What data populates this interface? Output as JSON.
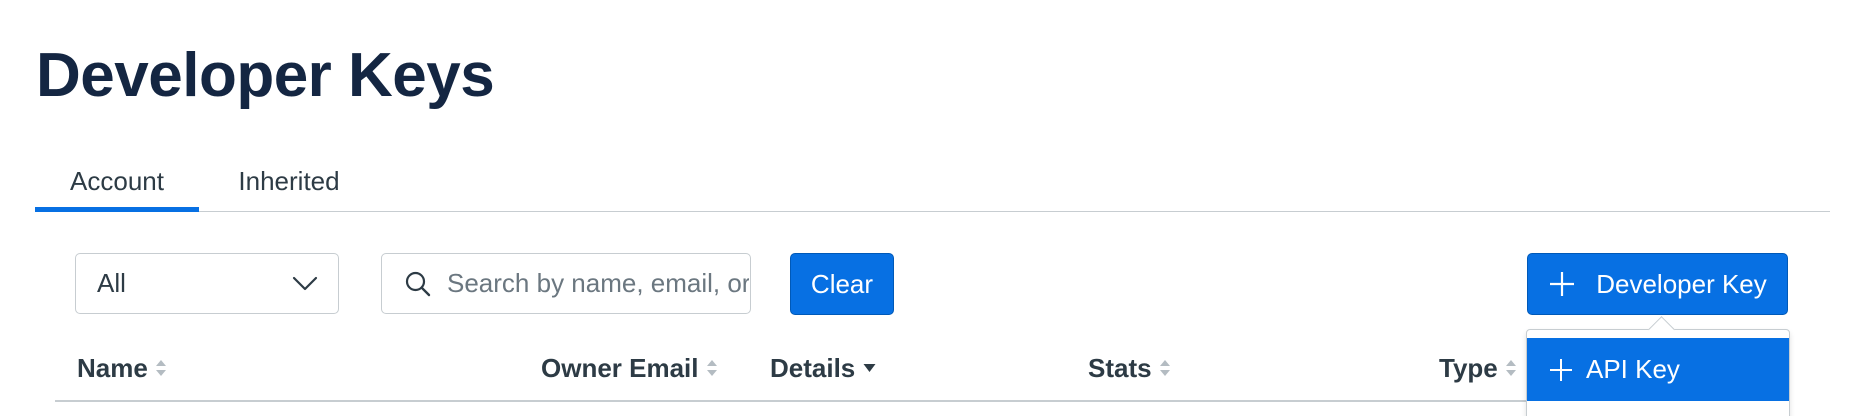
{
  "page": {
    "title": "Developer Keys"
  },
  "tabs": [
    {
      "label": "Account",
      "selected": true
    },
    {
      "label": "Inherited",
      "selected": false
    }
  ],
  "filters": {
    "type_select": {
      "value": "All"
    },
    "search": {
      "placeholder": "Search by name, email, or ID",
      "value": ""
    },
    "clear_label": "Clear"
  },
  "actions": {
    "add_key_label": "Developer Key",
    "menu": {
      "items": [
        {
          "label": "API Key",
          "highlighted": true
        }
      ]
    }
  },
  "table": {
    "columns": [
      {
        "label": "Name",
        "sort": "unsorted"
      },
      {
        "label": "Owner Email",
        "sort": "unsorted"
      },
      {
        "label": "Details",
        "sort": "descending"
      },
      {
        "label": "Stats",
        "sort": "unsorted"
      },
      {
        "label": "Type",
        "sort": "unsorted"
      }
    ]
  },
  "colors": {
    "accent": "#0770e3",
    "title": "#142642",
    "text": "#2d3b45",
    "border": "#c7cdd1"
  },
  "icons": {
    "search": "magnifier-icon",
    "select": "chevron-down-icon",
    "add": "plus-icon",
    "sort": "sort-icon",
    "sort_desc": "caret-down-icon"
  }
}
